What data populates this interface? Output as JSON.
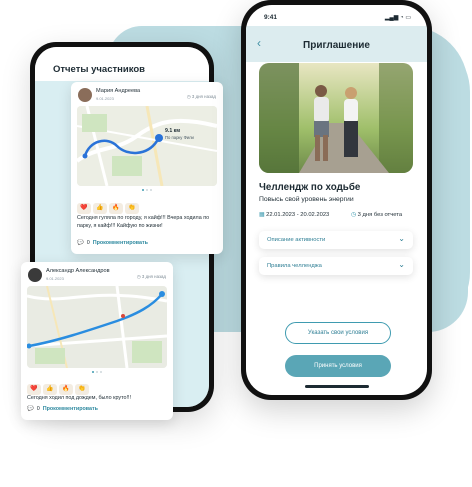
{
  "left_screen": {
    "title": "Отчеты участников",
    "cards": [
      {
        "user": "Мария Андреева",
        "date": "9.01.2023",
        "ago": "3 дня назад",
        "map": {
          "distance": "9.1 км",
          "place": "По парку Фили"
        },
        "reactions": [
          "❤️",
          "👍",
          "🔥",
          "👏"
        ],
        "text": "Сегодня гуляла по городу, я кайф!!! Вчера ходила по парку, я кайф!!! Кайфую по жизни!",
        "comments_count": "0",
        "comment_link": "Прокомментировать"
      },
      {
        "user": "Александр Александров",
        "date": "9.01.2023",
        "ago": "3 дня назад",
        "map": {
          "distance": "",
          "place": ""
        },
        "reactions": [
          "❤️",
          "👍",
          "🔥",
          "👏"
        ],
        "text": "Сегодня ходил под дождем, было круто!!!",
        "comments_count": "0",
        "comment_link": "Прокомментировать"
      }
    ]
  },
  "right_screen": {
    "status_time": "9:41",
    "status_icons": "▂▄▆ ◔ ▭",
    "title": "Приглашение",
    "back_icon": "‹",
    "challenge_title": "Челлендж по ходьбе",
    "challenge_subtitle": "Повысь свой уровень энергии",
    "dates": "22.01.2023 - 20.02.2023",
    "days_without_report": "3 дня без отчета",
    "accordions": [
      "Описание активности",
      "Правила челленджа"
    ],
    "btn_terms": "Указать свои условия",
    "btn_accept": "Принять условия"
  },
  "colors": {
    "accent": "#3f9bb0",
    "blob": "#bcdce2",
    "primary_button": "#5aa6b6"
  }
}
